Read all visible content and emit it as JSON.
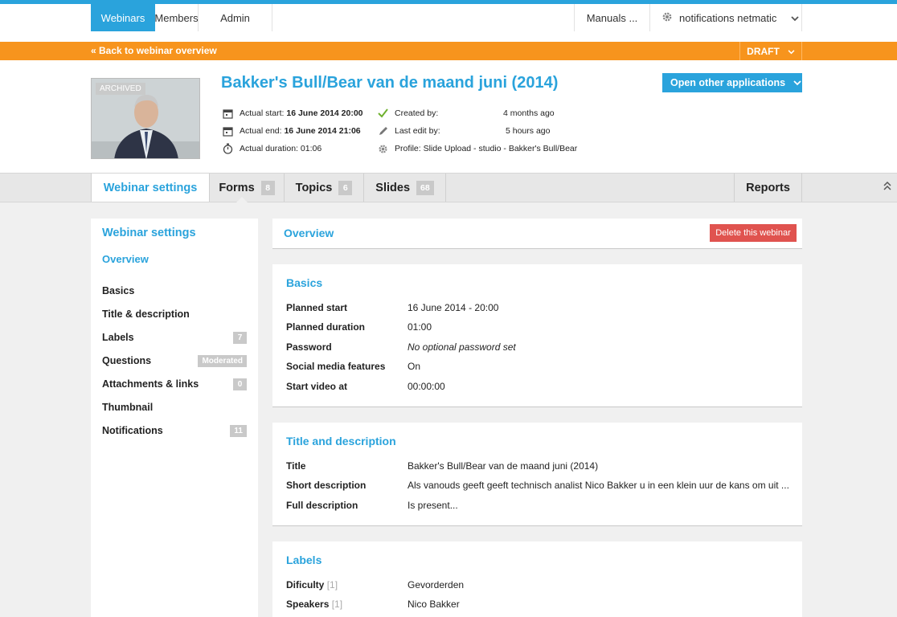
{
  "nav": {
    "items": [
      {
        "label": "Webinars"
      },
      {
        "label": "Members"
      },
      {
        "label": "Admin"
      }
    ],
    "manuals": "Manuals ...",
    "account": "notifications netmatic"
  },
  "subbar": {
    "back_label": "« Back to webinar overview",
    "status": "DRAFT"
  },
  "webinar": {
    "thumb_badge": "ARCHIVED",
    "title": "Bakker's Bull/Bear van de maand juni (2014)",
    "actual_start_label": "Actual start:",
    "actual_start": "16 June 2014 20:00",
    "actual_end_label": "Actual end:",
    "actual_end": "16 June 2014 21:06",
    "actual_duration_label": "Actual duration:",
    "actual_duration": "01:06",
    "created_by_label": "Created by:",
    "created_by": "4 months ago",
    "last_edit_label": "Last edit by:",
    "last_edit": "5 hours ago",
    "profile": "Profile: Slide Upload - studio - Bakker's Bull/Bear",
    "open_apps": "Open other applications"
  },
  "tabs": [
    {
      "label": "Webinar settings",
      "count": ""
    },
    {
      "label": "Forms",
      "count": "8"
    },
    {
      "label": "Topics",
      "count": "6"
    },
    {
      "label": "Slides",
      "count": "68"
    },
    {
      "label": "Reports",
      "count": ""
    }
  ],
  "sidebar": {
    "title": "Webinar settings",
    "overview": "Overview",
    "items": [
      {
        "label": "Basics",
        "badge": ""
      },
      {
        "label": "Title & description",
        "badge": ""
      },
      {
        "label": "Labels",
        "badge": "7"
      },
      {
        "label": "Questions",
        "badge": "Moderated"
      },
      {
        "label": "Attachments & links",
        "badge": "0"
      },
      {
        "label": "Thumbnail",
        "badge": ""
      },
      {
        "label": "Notifications",
        "badge": "11"
      }
    ]
  },
  "overview": {
    "title": "Overview",
    "delete_label": "Delete this webinar"
  },
  "basics": {
    "title": "Basics",
    "rows": [
      {
        "label": "Planned start",
        "value": "16 June 2014 - 20:00"
      },
      {
        "label": "Planned duration",
        "value": "01:00"
      },
      {
        "label": "Password",
        "value": "No optional password set"
      },
      {
        "label": "Social media features",
        "value": "On"
      },
      {
        "label": "Start video at",
        "value": "00:00:00"
      }
    ]
  },
  "title_desc": {
    "title": "Title and description",
    "rows": [
      {
        "label": "Title",
        "value": "Bakker's Bull/Bear van de maand juni (2014)"
      },
      {
        "label": "Short description",
        "value": "Als vanouds geeft geeft technisch analist Nico Bakker u in een klein uur de kans om uit ..."
      },
      {
        "label": "Full description",
        "value": "Is present..."
      }
    ]
  },
  "labels": {
    "title": "Labels",
    "rows": [
      {
        "label": "Dificulty",
        "count": "[1]",
        "value": "Gevorderden"
      },
      {
        "label": "Speakers",
        "count": "[1]",
        "value": "Nico Bakker"
      }
    ]
  },
  "colors": {
    "accent": "#2aa3dc",
    "orange": "#f7941d",
    "danger": "#e0534f"
  }
}
